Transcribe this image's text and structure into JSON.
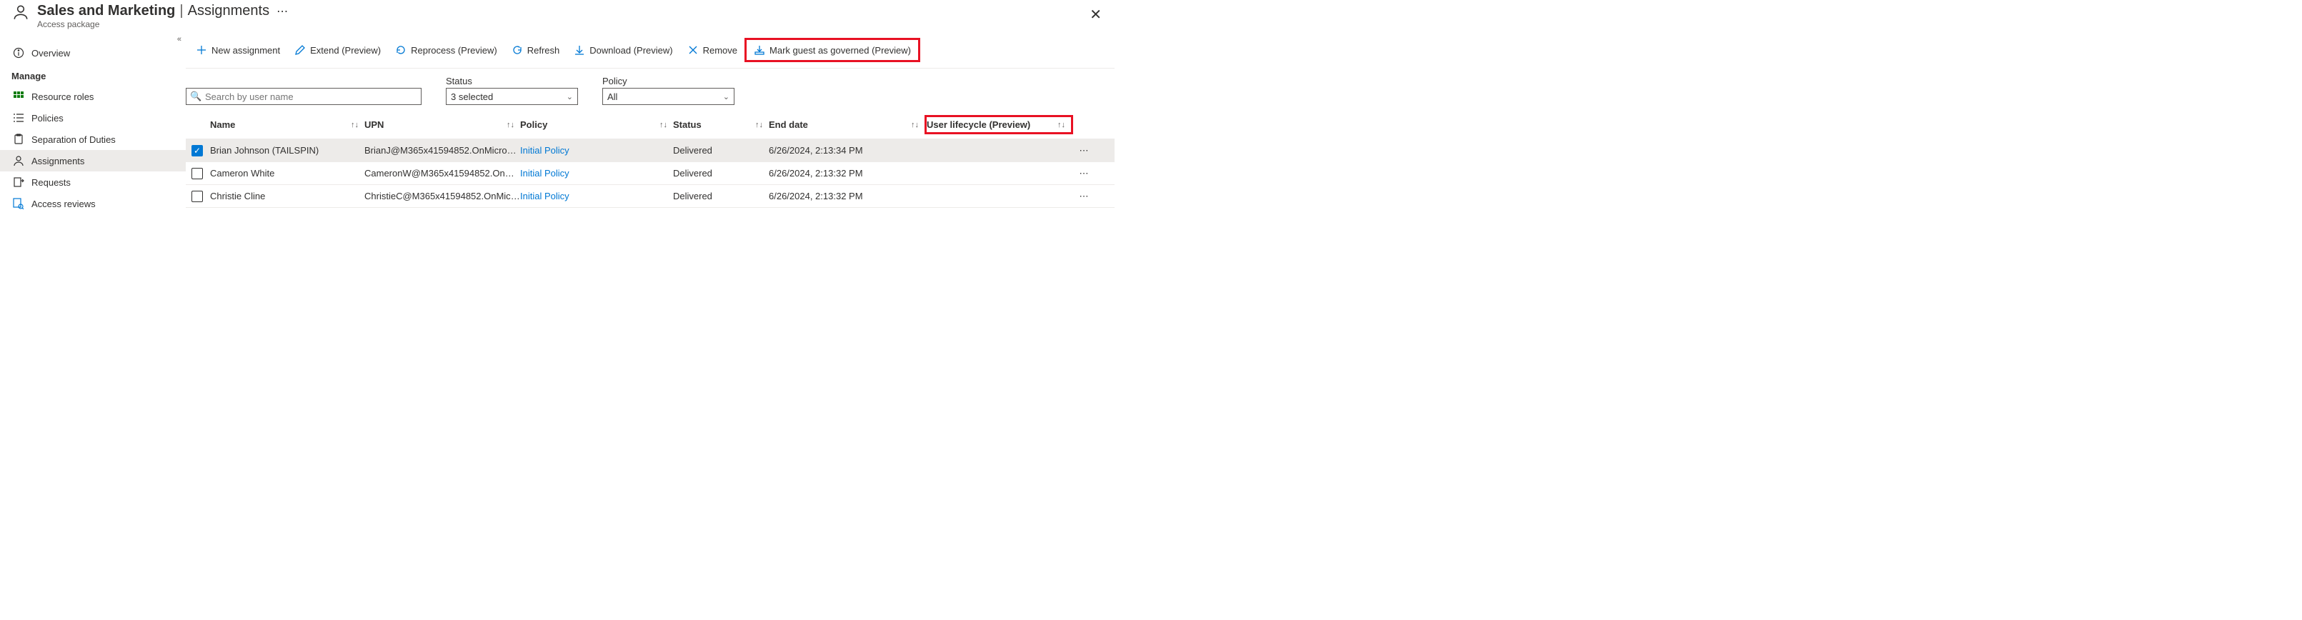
{
  "header": {
    "title_main": "Sales and Marketing",
    "title_sub": "Assignments",
    "subtitle": "Access package"
  },
  "sidebar": {
    "overview": "Overview",
    "manage_label": "Manage",
    "items": [
      {
        "label": "Resource roles"
      },
      {
        "label": "Policies"
      },
      {
        "label": "Separation of Duties"
      },
      {
        "label": "Assignments"
      },
      {
        "label": "Requests"
      },
      {
        "label": "Access reviews"
      }
    ]
  },
  "toolbar": {
    "new": "New assignment",
    "extend": "Extend (Preview)",
    "reprocess": "Reprocess (Preview)",
    "refresh": "Refresh",
    "download": "Download (Preview)",
    "remove": "Remove",
    "mark_governed": "Mark guest as governed (Preview)"
  },
  "filters": {
    "search_placeholder": "Search by user name",
    "status_label": "Status",
    "status_value": "3 selected",
    "policy_label": "Policy",
    "policy_value": "All"
  },
  "columns": {
    "name": "Name",
    "upn": "UPN",
    "policy": "Policy",
    "status": "Status",
    "end": "End date",
    "life": "User lifecycle (Preview)"
  },
  "rows": [
    {
      "checked": true,
      "name": "Brian Johnson (TAILSPIN)",
      "upn": "BrianJ@M365x41594852.OnMicros…",
      "policy": "Initial Policy",
      "status": "Delivered",
      "end": "6/26/2024, 2:13:34 PM",
      "life": ""
    },
    {
      "checked": false,
      "name": "Cameron White",
      "upn": "CameronW@M365x41594852.OnM…",
      "policy": "Initial Policy",
      "status": "Delivered",
      "end": "6/26/2024, 2:13:32 PM",
      "life": ""
    },
    {
      "checked": false,
      "name": "Christie Cline",
      "upn": "ChristieC@M365x41594852.OnMicr…",
      "policy": "Initial Policy",
      "status": "Delivered",
      "end": "6/26/2024, 2:13:32 PM",
      "life": ""
    }
  ]
}
